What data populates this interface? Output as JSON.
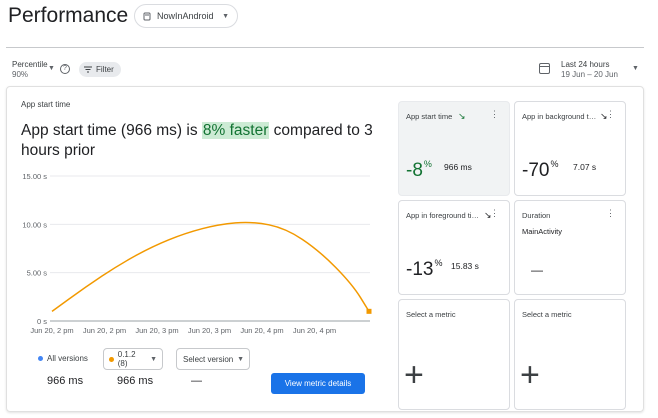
{
  "header": {
    "title": "Performance",
    "app_selector": {
      "value": "NowInAndroid",
      "icon": "android-app-icon"
    }
  },
  "filters": {
    "percentile_label": "Percentile",
    "percentile_value": "90%",
    "filter_label": "Filter",
    "date_label": "Last 24 hours",
    "date_range": "19 Jun – 20 Jun"
  },
  "detail": {
    "section_label": "App start time",
    "headline_pre": "App start time (966 ms) is ",
    "headline_highlight": "8% faster",
    "headline_post": " compared to 3 hours prior",
    "legend": {
      "all_versions": "All versions",
      "version_selected": "0.1.2 (8)",
      "select_version": "Select version"
    },
    "values": {
      "all": "966 ms",
      "version": "966 ms",
      "selected": "—"
    },
    "cta_label": "View metric details"
  },
  "chart_data": {
    "type": "line",
    "y_ticks": [
      "15.00 s",
      "10.00 s",
      "5.00 s",
      "0 s"
    ],
    "ylim": [
      0,
      15
    ],
    "x_ticks": [
      "Jun 20, 2 pm",
      "Jun 20, 2 pm",
      "Jun 20, 3 pm",
      "Jun 20, 3 pm",
      "Jun 20, 4 pm",
      "Jun 20, 4 pm"
    ],
    "series": [
      {
        "color": "#f29900",
        "points": [
          [
            0,
            1.0
          ],
          [
            1,
            3.5
          ],
          [
            2,
            5.8
          ],
          [
            3,
            7.7
          ],
          [
            4,
            9.1
          ],
          [
            5,
            10.0
          ],
          [
            6,
            10.3
          ],
          [
            7,
            9.6
          ],
          [
            8,
            7.3
          ],
          [
            9,
            3.8
          ],
          [
            9.5,
            1.0
          ]
        ]
      }
    ],
    "colors": {
      "all_versions": "#4285f4",
      "version": "#f29900"
    }
  },
  "tiles": [
    {
      "title": "App start time",
      "trend": "↘",
      "trend_color": "#137333",
      "value": "-8",
      "unit": "%",
      "secondary": "966 ms",
      "active": true,
      "value_color": "#137333"
    },
    {
      "title": "App in background t…",
      "trend": "↘",
      "trend_color": "#202124",
      "value": "-70",
      "unit": "%",
      "secondary": "7.07 s"
    },
    {
      "title": "App in foreground ti…",
      "trend": "↘",
      "trend_color": "#202124",
      "value": "-13",
      "unit": "%",
      "secondary": "15.83 s"
    },
    {
      "title": "Duration",
      "subtitle": "MainActivity",
      "value": "—"
    },
    {
      "title": "Select a metric",
      "plus": "+"
    },
    {
      "title": "Select a metric",
      "plus": "+"
    }
  ],
  "more_glyph": "⋮"
}
